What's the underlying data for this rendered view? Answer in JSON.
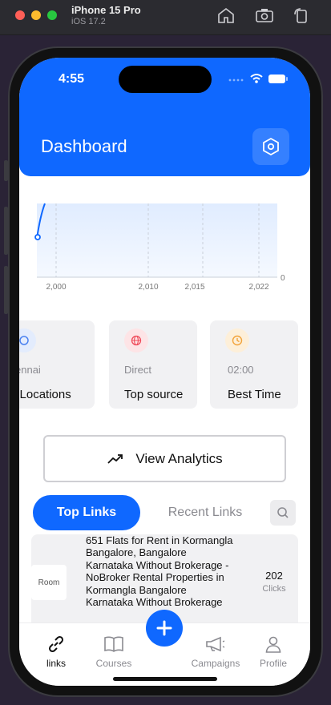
{
  "simulator": {
    "device_name": "iPhone 15 Pro",
    "os_version": "iOS 17.2"
  },
  "status_bar": {
    "time": "4:55"
  },
  "header": {
    "title": "Dashboard",
    "settings_icon": "hexagon-settings-icon"
  },
  "chart_data": {
    "type": "line",
    "x_ticks": [
      "2,000",
      "2,010",
      "2,015",
      "2,022"
    ],
    "y_ticks": [
      "0"
    ],
    "grid": true,
    "colors": {
      "line": "#0f68ff",
      "fill": "#e6f0ff"
    }
  },
  "stats": [
    {
      "label": "p Locations",
      "value": "ennai",
      "icon": "location-icon",
      "color": "#4b82f0"
    },
    {
      "label": "Top source",
      "value": "Direct",
      "icon": "globe-icon",
      "color": "#ef4b5a"
    },
    {
      "label": "Best Time",
      "value": "02:00",
      "icon": "clock-icon",
      "color": "#f2a33a"
    }
  ],
  "analytics_button": {
    "label": "View Analytics",
    "icon": "trending-up-icon"
  },
  "tabs": {
    "top": "Top Links",
    "recent": "Recent Links",
    "active": "Top Links"
  },
  "link_item": {
    "thumb_text": "Room",
    "title": "651   Flats for Rent in Kormangla Bangalore, Bangalore Karnataka Without Brokerage - NoBroker Rental Properties in Kormangla Bangalore Karnataka Without Brokerage",
    "clicks": "202",
    "clicks_label": "Clicks"
  },
  "nav": {
    "items": [
      {
        "label": "links",
        "icon": "link-icon",
        "active": true
      },
      {
        "label": "Courses",
        "icon": "book-icon",
        "active": false
      },
      {
        "label": "Campaigns",
        "icon": "megaphone-icon",
        "active": false
      },
      {
        "label": "Profile",
        "icon": "person-icon",
        "active": false
      }
    ],
    "fab_icon": "plus-icon"
  },
  "colors": {
    "primary": "#0f68ff",
    "card_bg": "#f1f1f3"
  }
}
